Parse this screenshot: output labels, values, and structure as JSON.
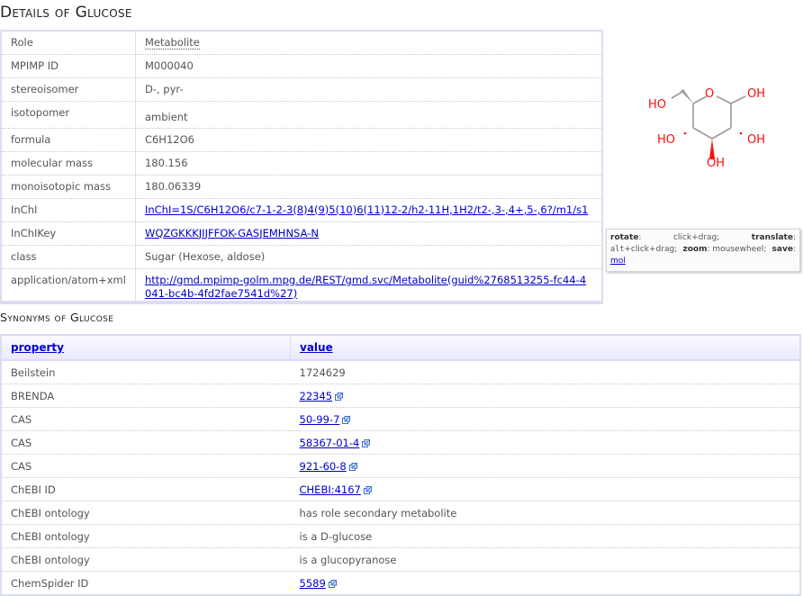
{
  "details": {
    "title": "Details of Glucose",
    "rows": [
      {
        "key": "Role",
        "value": "Metabolite",
        "kind": "dotted"
      },
      {
        "key": "MPIMP ID",
        "value": "M000040",
        "kind": "text"
      },
      {
        "key": "stereoisomer",
        "value": "D-, pyr-",
        "kind": "text"
      },
      {
        "key": "isotopomer",
        "value": "ambient",
        "kind": "text"
      },
      {
        "key": "formula",
        "value": "C6H12O6",
        "kind": "text"
      },
      {
        "key": "molecular mass",
        "value": "180.156",
        "kind": "text"
      },
      {
        "key": "monoisotopic mass",
        "value": "180.06339",
        "kind": "text"
      },
      {
        "key": "InChI",
        "value": "InChI=1S/C6H12O6/c7-1-2-3(8)4(9)5(10)6(11)12-2/h2-11H,1H2/t2-,3-,4+,5-,6?/m1/s1",
        "kind": "link"
      },
      {
        "key": "InChIKey",
        "value": "WQZGKKKJIJFFOK-GASJEMHNSA-N",
        "kind": "link"
      },
      {
        "key": "class",
        "value": "Sugar (Hexose, aldose)",
        "kind": "text"
      },
      {
        "key": "application/atom+xml",
        "value": "http://gmd.mpimp-golm.mpg.de/REST/gmd.svc/Metabolite(guid%2768513255-fc44-4041-bc4b-4fd2fae7541d%27)",
        "kind": "link"
      }
    ]
  },
  "molecule": {
    "labels": {
      "ho_top": "HO",
      "oh_right_top": "OH",
      "ho_left": "HO",
      "oh_right": "OH",
      "oh_bottom": "OH",
      "ring_o": "O"
    },
    "colors": {
      "bond": "#9a9a9a",
      "oxygen": "#ff0d0d"
    },
    "help": {
      "rotate_label": "rotate",
      "rotate_value": "click+drag;",
      "translate_label": "translate",
      "translate_key": "alt",
      "translate_value": "+click+drag;",
      "zoom_label": "zoom",
      "zoom_value": "mousewheel;",
      "save_label": "save",
      "save_link": "mol"
    }
  },
  "synonyms": {
    "title": "Synonyms of Glucose",
    "headers": {
      "property": "property",
      "value": "value"
    },
    "rows": [
      {
        "property": "Beilstein",
        "value": "1724629",
        "link": false
      },
      {
        "property": "BRENDA",
        "value": "22345",
        "link": true
      },
      {
        "property": "CAS",
        "value": "50-99-7",
        "link": true
      },
      {
        "property": "CAS",
        "value": "58367-01-4",
        "link": true
      },
      {
        "property": "CAS",
        "value": "921-60-8",
        "link": true
      },
      {
        "property": "ChEBI ID",
        "value": "CHEBI:4167",
        "link": true
      },
      {
        "property": "ChEBI ontology",
        "value": "has role secondary metabolite",
        "link": false
      },
      {
        "property": "ChEBI ontology",
        "value": "is a D-glucose",
        "link": false
      },
      {
        "property": "ChEBI ontology",
        "value": "is a glucopyranose",
        "link": false
      },
      {
        "property": "ChemSpider ID",
        "value": "5589",
        "link": true
      }
    ]
  },
  "colors": {
    "link": "#0000cc",
    "border": "#dcdcf2",
    "text": "#555555"
  }
}
